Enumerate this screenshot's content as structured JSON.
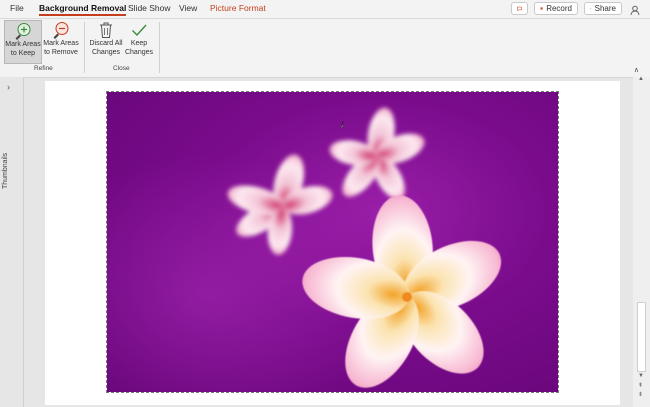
{
  "tabs": {
    "file": "File",
    "background_removal": "Background Removal",
    "slide_show": "Slide Show",
    "view": "View",
    "picture_format": "Picture Format"
  },
  "top_right": {
    "record_label": "Record",
    "share_label": "Share"
  },
  "ribbon": {
    "mark_keep": [
      "Mark Areas",
      "to Keep"
    ],
    "mark_remove": [
      "Mark Areas",
      "to Remove"
    ],
    "discard": [
      "Discard All",
      "Changes"
    ],
    "keep": [
      "Keep",
      "Changes"
    ],
    "group_refine": "Refine",
    "group_close": "Close",
    "collapse_glyph": "∧"
  },
  "thumbnails": {
    "label": "Thumbnails",
    "arrow": "›"
  },
  "colors": {
    "accent": "#c43e1c",
    "removal_purple": "#7a0c8c"
  }
}
